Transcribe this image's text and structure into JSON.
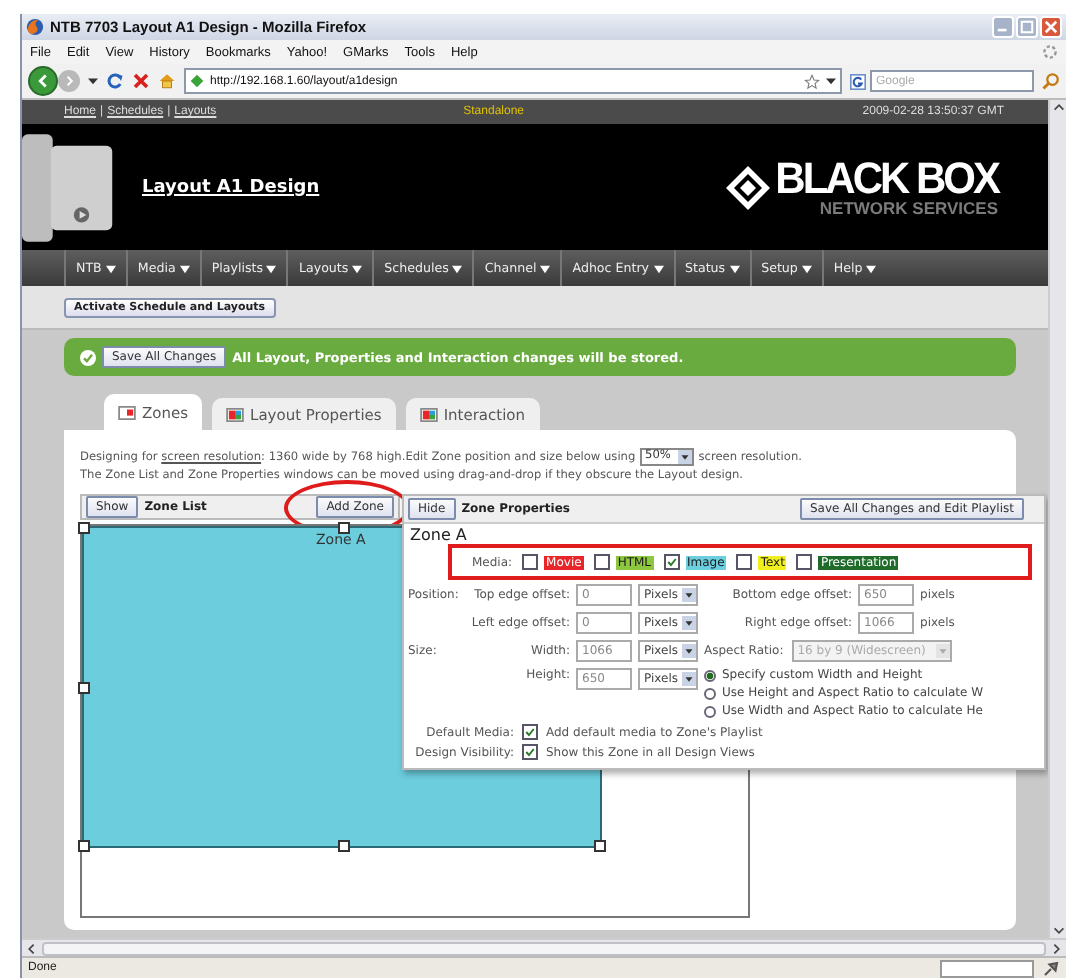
{
  "window": {
    "title": "NTB 7703 Layout A1 Design - Mozilla Firefox"
  },
  "menu": [
    "File",
    "Edit",
    "View",
    "History",
    "Bookmarks",
    "Yahoo!",
    "GMarks",
    "Tools",
    "Help"
  ],
  "toolbar": {
    "url": "http://192.168.1.60/layout/a1design",
    "search_placeholder": "Google"
  },
  "top_strip": {
    "links": [
      "Home",
      "Schedules",
      "Layouts"
    ],
    "separator": "|",
    "mode": "Standalone",
    "datetime": "2009-02-28 13:50:37 GMT"
  },
  "header": {
    "title": "Layout A1 Design",
    "brand": "BLACK BOX",
    "brand_sub": "NETWORK SERVICES"
  },
  "nav": [
    "NTB",
    "Media",
    "Playlists",
    "Layouts",
    "Schedules",
    "Channel",
    "Adhoc Entry",
    "Status",
    "Setup",
    "Help"
  ],
  "activate_button": "Activate Schedule and Layouts",
  "notice": {
    "button": "Save All Changes",
    "message": "All Layout, Properties and Interaction changes will be stored."
  },
  "tabs": [
    {
      "label": "Zones",
      "selected": true
    },
    {
      "label": "Layout Properties",
      "selected": false
    },
    {
      "label": "Interaction",
      "selected": false
    }
  ],
  "description": {
    "prefix": "Designing for",
    "link": "screen resolution",
    "middle": ": 1360 wide by 768 high.Edit Zone position and size below using",
    "scale": "50%",
    "suffix": "screen resolution.",
    "line2": "The Zone List and Zone Properties windows can be moved using drag-and-drop if they obscure the Layout design."
  },
  "zone_list": {
    "show_button": "Show",
    "title": "Zone List",
    "add_button": "Add Zone",
    "zone_label": "Zone A"
  },
  "zone_properties": {
    "hide_button": "Hide",
    "title": "Zone Properties",
    "save_button": "Save All Changes and Edit Playlist",
    "zone_name": "Zone A",
    "media_label": "Media:",
    "media": [
      {
        "label": "Movie",
        "checked": false,
        "color": "#e8262a"
      },
      {
        "label": "HTML",
        "checked": false,
        "color": "#8dc63f"
      },
      {
        "label": "Image",
        "checked": true,
        "color": "#6ccfe0"
      },
      {
        "label": "Text",
        "checked": false,
        "color": "#f2ef1e"
      },
      {
        "label": "Presentation",
        "checked": false,
        "color": "#1e6b2a"
      }
    ],
    "position_label": "Position:",
    "top_label": "Top edge offset:",
    "top_value": "0",
    "top_unit": "Pixels",
    "bottom_label": "Bottom edge offset:",
    "bottom_value": "650",
    "bottom_unit": "pixels",
    "left_label": "Left edge offset:",
    "left_value": "0",
    "left_unit": "Pixels",
    "right_label": "Right edge offset:",
    "right_value": "1066",
    "right_unit": "pixels",
    "size_label": "Size:",
    "width_label": "Width:",
    "width_value": "1066",
    "width_unit": "Pixels",
    "aspect_label": "Aspect Ratio:",
    "aspect_value": "16 by 9 (Widescreen)",
    "height_label": "Height:",
    "height_value": "650",
    "height_unit": "Pixels",
    "sizing_options": [
      {
        "label": "Specify custom Width and Height",
        "selected": true
      },
      {
        "label": "Use Height and Aspect Ratio to calculate W",
        "selected": false
      },
      {
        "label": "Use Width and Aspect Ratio to calculate He",
        "selected": false
      }
    ],
    "default_media_label": "Default Media:",
    "default_media": {
      "label": "Add default media to Zone's Playlist",
      "checked": true
    },
    "visibility_label": "Design Visibility:",
    "visibility": {
      "label": "Show this Zone in all Design Views",
      "checked": true
    }
  },
  "status_bar": {
    "text": "Done"
  }
}
